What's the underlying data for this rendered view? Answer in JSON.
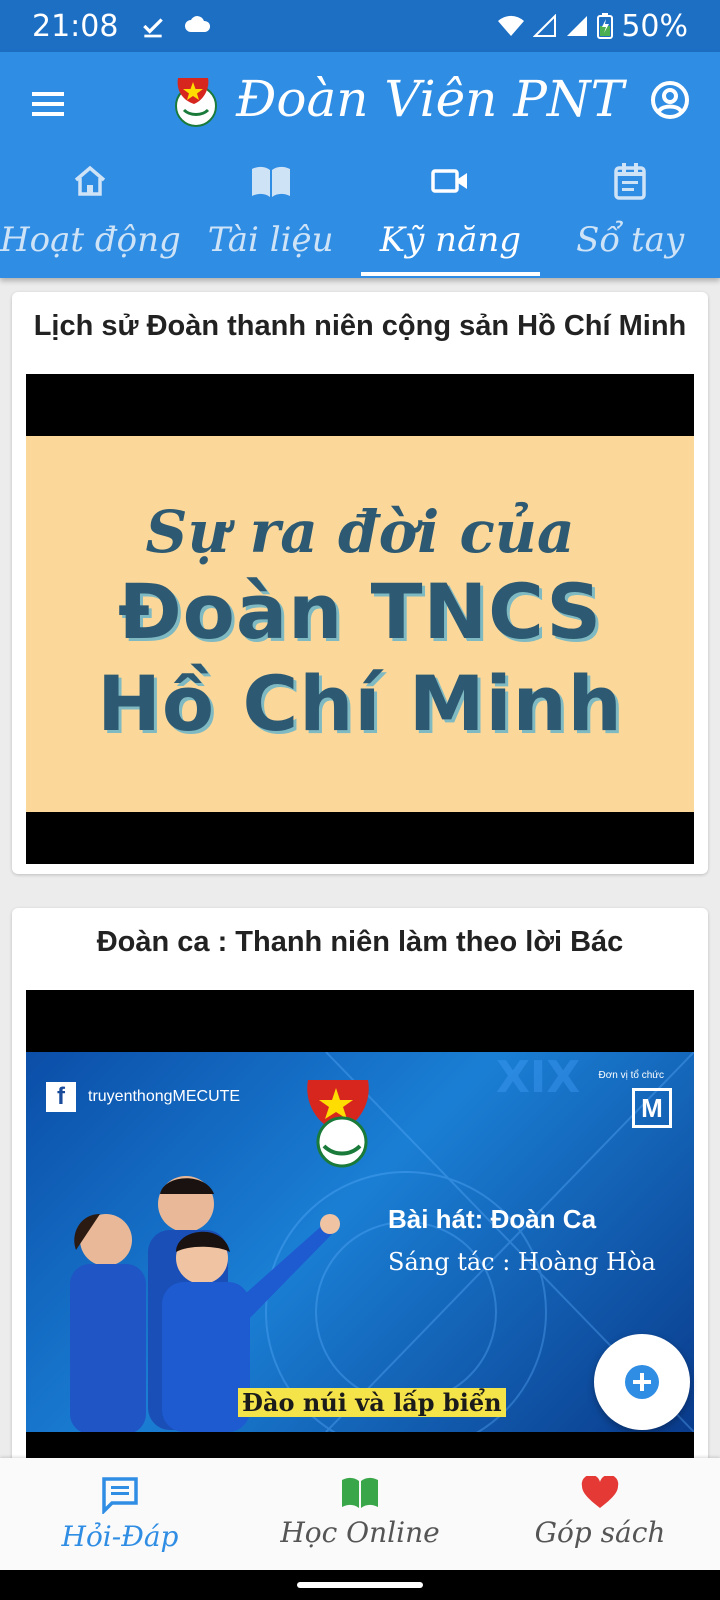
{
  "status_bar": {
    "time": "21:08",
    "battery": "50%",
    "icons": [
      "download-done-icon",
      "cloud-icon",
      "wifi-icon",
      "signal-icon",
      "battery-charging-icon"
    ]
  },
  "app_bar": {
    "title": "Đoàn Viên PNT",
    "menu_icon": "menu-icon",
    "account_icon": "account-circle-icon"
  },
  "tabs": [
    {
      "label": "Hoạt động",
      "icon": "home-icon",
      "active": false
    },
    {
      "label": "Tài liệu",
      "icon": "book-icon",
      "active": false
    },
    {
      "label": "Kỹ năng",
      "icon": "video-camera-icon",
      "active": true
    },
    {
      "label": "Sổ tay",
      "icon": "notebook-icon",
      "active": false
    }
  ],
  "cards": [
    {
      "title": "Lịch sử Đoàn thanh niên cộng sản Hồ Chí Minh",
      "thumbnail": {
        "line1": "Sự ra đời của",
        "line2": "Đoàn TNCS",
        "line3": "Hồ Chí Minh"
      }
    },
    {
      "title": "Đoàn ca : Thanh niên làm theo lời Bác",
      "thumbnail": {
        "facebook_page": "truyenthongMECUTE",
        "organizer": "Đơn vị tổ chức",
        "brand": "M",
        "song": "Bài hát: Đoàn Ca",
        "composer": "Sáng tác : Hoàng Hòa",
        "lyric": "Đào núi và lấp biển"
      }
    }
  ],
  "fab": {
    "icon": "add-circle-icon"
  },
  "bottom_nav": [
    {
      "label": "Hỏi-Đáp",
      "icon": "chat-icon",
      "active": true,
      "color": "#2f8de4"
    },
    {
      "label": "Học Online",
      "icon": "open-book-icon",
      "active": false,
      "color": "#3aa64a"
    },
    {
      "label": "Góp sách",
      "icon": "heart-icon",
      "active": false,
      "color": "#e53935"
    }
  ],
  "colors": {
    "status_bar": "#1d6fc4",
    "app_bar": "#2f8de4",
    "thumb1_bg": "#fbd89a",
    "thumb1_text": "#2d5a72"
  }
}
